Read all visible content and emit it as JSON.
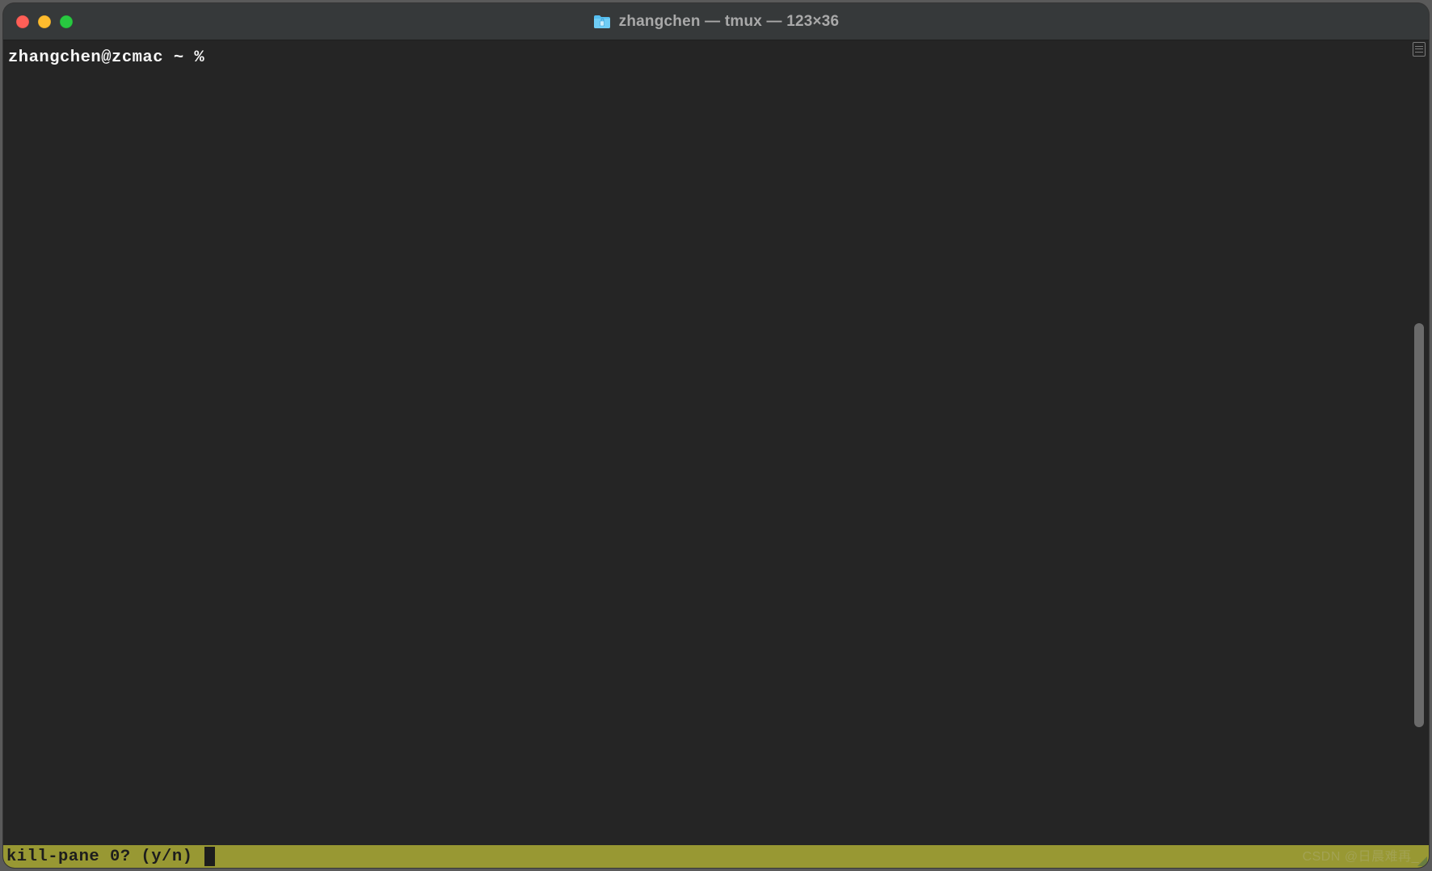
{
  "window": {
    "title": "zhangchen — tmux — 123×36"
  },
  "terminal": {
    "prompt": "zhangchen@zcmac ~ % "
  },
  "status": {
    "prompt": "kill-pane 0? (y/n) "
  },
  "watermark": "CSDN @日晨难再_"
}
